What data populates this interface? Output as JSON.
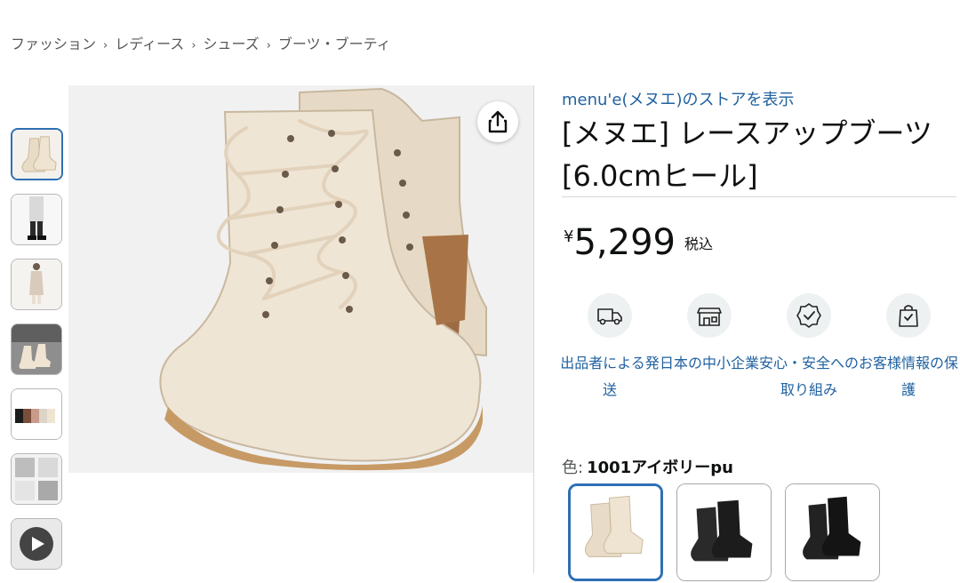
{
  "breadcrumb": {
    "items": [
      "ファッション",
      "レディース",
      "シューズ",
      "ブーツ・ブーティ"
    ],
    "separator": "›"
  },
  "store_link": "menu'e(メヌエ)のストアを表示",
  "product": {
    "title": "[メヌエ] レースアップブーツ[6.0cmヒール]",
    "price_symbol": "¥",
    "price": "5,299",
    "tax_note": "税込"
  },
  "features": [
    {
      "icon": "delivery-truck-icon",
      "label": "出品者による発送"
    },
    {
      "icon": "storefront-icon",
      "label": "日本の中小企業"
    },
    {
      "icon": "safety-badge-icon",
      "label": "安心・安全への取り組み"
    },
    {
      "icon": "protected-bag-icon",
      "label": "お客様情報の保護"
    }
  ],
  "variation": {
    "label": "色:",
    "selected_value": "1001アイボリーpu"
  },
  "colors": {
    "link": "#2162a1",
    "selected_border": "#2f6fb5",
    "boot_ivory": "#efe4d2",
    "boot_black": "#1c1c1c"
  },
  "thumbnails": [
    "boot-pair",
    "model-legs",
    "model-full",
    "lifestyle",
    "color-lineup",
    "collage",
    "video"
  ]
}
